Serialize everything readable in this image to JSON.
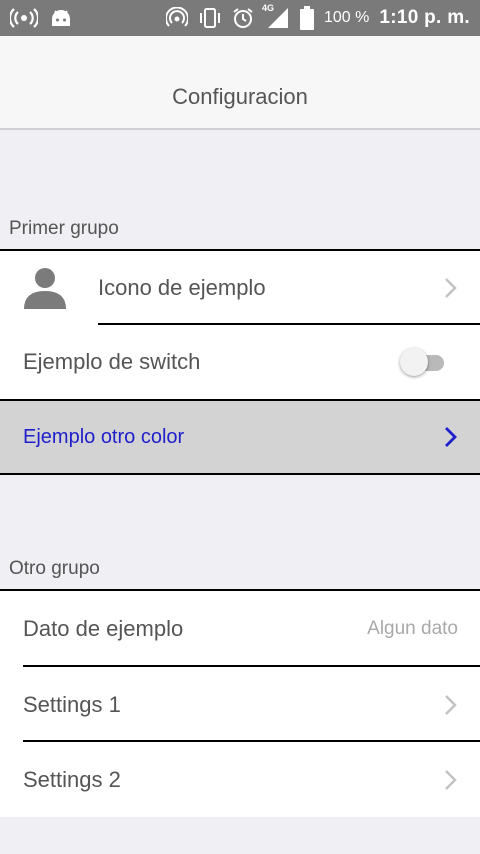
{
  "status_bar": {
    "battery_text": "100 %",
    "time": "1:10 p. m.",
    "network_badge": "4G",
    "icons": [
      "wireless-broadcast-icon",
      "android-icon",
      "hotspot-icon",
      "vibrate-icon",
      "alarm-icon",
      "signal-icon",
      "battery-icon"
    ]
  },
  "header": {
    "title": "Configuracion"
  },
  "groups": [
    {
      "title": "Primer grupo",
      "rows": [
        {
          "label": "Icono de ejemplo",
          "icon": "person-icon",
          "accessory": "chevron-right-icon"
        },
        {
          "label": "Ejemplo de switch",
          "accessory": "switch",
          "switch_on": false
        },
        {
          "label": "Ejemplo otro color",
          "accessory": "chevron-right-icon",
          "text_color": "#1f1fcc",
          "background": "#d3d3d3"
        }
      ]
    },
    {
      "title": "Otro grupo",
      "rows": [
        {
          "label": "Dato de ejemplo",
          "value": "Algun dato"
        },
        {
          "label": "Settings 1",
          "accessory": "chevron-right-icon"
        },
        {
          "label": "Settings 2",
          "accessory": "chevron-right-icon"
        }
      ]
    }
  ],
  "colors": {
    "status_bar": "#7a7a7a",
    "background": "#efeff4",
    "accent_blue": "#1f1fcc",
    "highlight_row": "#d3d3d3"
  }
}
